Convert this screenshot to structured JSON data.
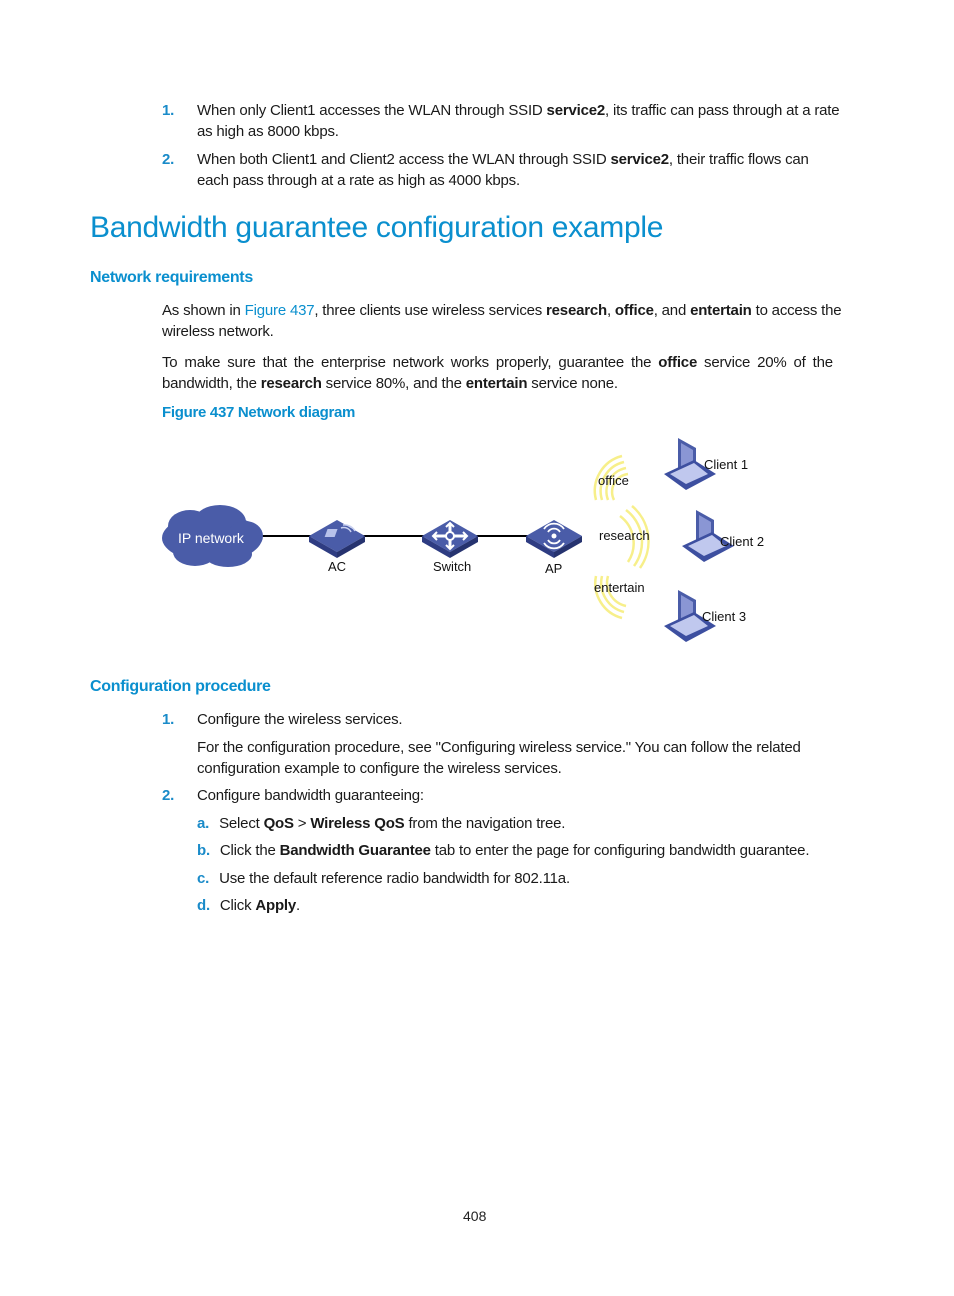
{
  "intro_list": [
    {
      "num": "1.",
      "pre": "When only Client1 accesses the WLAN through SSID ",
      "bold": "service2",
      "post": ", its traffic can pass through at a rate",
      "line2": "as high as 8000 kbps."
    },
    {
      "num": "2.",
      "pre": "When both Client1 and Client2 access the WLAN through SSID ",
      "bold": "service2",
      "post": ", their traffic flows can",
      "line2": "each pass through at a rate as high as 4000 kbps."
    }
  ],
  "heading": "Bandwidth guarantee configuration example",
  "network_requirements": {
    "title": "Network requirements",
    "p1": {
      "a": "As shown in ",
      "link": "Figure 437",
      "b": ", three clients use wireless services ",
      "s1": "research",
      "c": ", ",
      "s2": "office",
      "d": ", and ",
      "s3": "entertain",
      "e": " to access the",
      "line2": "wireless network."
    },
    "p2": {
      "a": "To make sure that the enterprise network works properly, guarantee the ",
      "s1": "office",
      "b": " service 20% of the",
      "c": "bandwidth, the ",
      "s2": "research",
      "d": " service 80%, and the ",
      "s3": "entertain",
      "e": " service none."
    },
    "figure_caption": "Figure 437 Network diagram"
  },
  "diagram": {
    "cloud_label": "IP network",
    "ac_label": "AC",
    "switch_label": "Switch",
    "switch_tag": "SWITCH",
    "ap_label": "AP",
    "services": [
      "office",
      "research",
      "entertain"
    ],
    "clients": [
      "Client 1",
      "Client 2",
      "Client 3"
    ],
    "colors": {
      "device": "#3d4fa0",
      "device_light": "#6a78c0",
      "wave": "#f7ef8a",
      "line": "#000000"
    }
  },
  "config_procedure": {
    "title": "Configuration procedure",
    "step1": {
      "num": "1.",
      "text": "Configure the wireless services.",
      "detail1": "For the configuration procedure, see \"Configuring wireless service.\" You can follow the related",
      "detail2": "configuration example to configure the wireless services."
    },
    "step2": {
      "num": "2.",
      "text": "Configure bandwidth guaranteeing:"
    },
    "substeps": [
      {
        "letter": "a.",
        "a": "Select ",
        "b1": "QoS",
        "b": " > ",
        "b2": "Wireless QoS",
        "c": " from the navigation tree."
      },
      {
        "letter": "b.",
        "a": "Click the ",
        "b1": "Bandwidth Guarantee",
        "c": " tab to enter the page for configuring bandwidth guarantee."
      },
      {
        "letter": "c.",
        "a": "Use the default reference radio bandwidth for 802.11a."
      },
      {
        "letter": "d.",
        "a": "Click ",
        "b1": "Apply",
        "c": "."
      }
    ]
  },
  "page_number": "408"
}
